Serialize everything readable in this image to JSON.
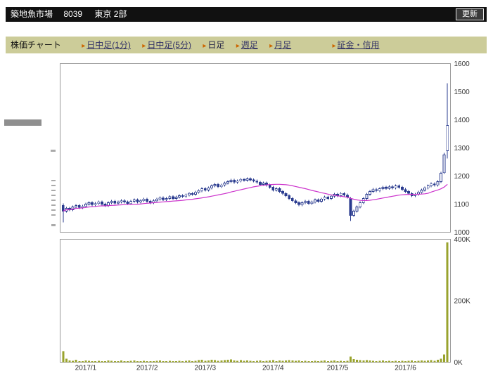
{
  "header": {
    "name": "築地魚市場",
    "code": "8039",
    "market": "東京 2部",
    "refresh_label": "更新"
  },
  "nav": {
    "label": "株価チャート",
    "bullet": "▸",
    "items": [
      {
        "label": "日中足(1分)",
        "active": false
      },
      {
        "label": "日中足(5分)",
        "active": false
      },
      {
        "label": "日足",
        "active": true
      },
      {
        "label": "週足",
        "active": false
      },
      {
        "label": "月足",
        "active": false
      },
      {
        "label": "証金・信用",
        "active": false
      }
    ]
  },
  "chart_data": {
    "type": "candlestick_with_volume",
    "title": "",
    "x_range": "2017/1 - 2017/6",
    "y_axis": {
      "min": 1000,
      "max": 1600,
      "ticks": [
        1000,
        1100,
        1200,
        1300,
        1400,
        1500,
        1600
      ],
      "position": "right"
    },
    "volume_axis": {
      "min": 0,
      "max": 400000,
      "position": "right",
      "ticks": [
        {
          "label": "0K",
          "value": 0
        },
        {
          "label": "200K",
          "value": 200000
        },
        {
          "label": "400K",
          "value": 400000
        }
      ]
    },
    "x_ticks": [
      {
        "label": "2017/1",
        "center_index": 7
      },
      {
        "label": "2017/2",
        "center_index": 26
      },
      {
        "label": "2017/3",
        "center_index": 44
      },
      {
        "label": "2017/4",
        "center_index": 65
      },
      {
        "label": "2017/5",
        "center_index": 85
      },
      {
        "label": "2017/6",
        "center_index": 106
      }
    ],
    "ma_period": 25,
    "colors": {
      "candle": "#2a3b8f",
      "candle_up_fill": "#ffffff",
      "ma": "#cc33cc",
      "volume": "#99a32e",
      "border": "#999999"
    },
    "candles": [
      [
        1095,
        1102,
        1035,
        1075
      ],
      [
        1075,
        1090,
        1070,
        1085
      ],
      [
        1085,
        1090,
        1075,
        1080
      ],
      [
        1080,
        1095,
        1075,
        1090
      ],
      [
        1090,
        1100,
        1085,
        1095
      ],
      [
        1095,
        1100,
        1083,
        1088
      ],
      [
        1088,
        1097,
        1083,
        1092
      ],
      [
        1092,
        1105,
        1087,
        1100
      ],
      [
        1100,
        1110,
        1095,
        1105
      ],
      [
        1105,
        1110,
        1093,
        1098
      ],
      [
        1098,
        1107,
        1093,
        1102
      ],
      [
        1102,
        1113,
        1097,
        1108
      ],
      [
        1108,
        1113,
        1095,
        1100
      ],
      [
        1100,
        1105,
        1090,
        1095
      ],
      [
        1095,
        1110,
        1090,
        1105
      ],
      [
        1105,
        1115,
        1100,
        1110
      ],
      [
        1110,
        1115,
        1099,
        1104
      ],
      [
        1104,
        1113,
        1099,
        1108
      ],
      [
        1108,
        1117,
        1103,
        1112
      ],
      [
        1112,
        1117,
        1103,
        1108
      ],
      [
        1108,
        1113,
        1097,
        1102
      ],
      [
        1102,
        1115,
        1097,
        1110
      ],
      [
        1110,
        1120,
        1105,
        1115
      ],
      [
        1115,
        1120,
        1103,
        1108
      ],
      [
        1108,
        1117,
        1103,
        1112
      ],
      [
        1112,
        1123,
        1107,
        1118
      ],
      [
        1118,
        1123,
        1105,
        1110
      ],
      [
        1110,
        1115,
        1100,
        1105
      ],
      [
        1105,
        1117,
        1100,
        1112
      ],
      [
        1112,
        1123,
        1107,
        1118
      ],
      [
        1118,
        1127,
        1113,
        1122
      ],
      [
        1122,
        1127,
        1111,
        1116
      ],
      [
        1116,
        1125,
        1111,
        1120
      ],
      [
        1120,
        1131,
        1115,
        1126
      ],
      [
        1126,
        1131,
        1115,
        1120
      ],
      [
        1120,
        1130,
        1115,
        1125
      ],
      [
        1125,
        1135,
        1120,
        1130
      ],
      [
        1130,
        1135,
        1123,
        1128
      ],
      [
        1128,
        1137,
        1123,
        1132
      ],
      [
        1132,
        1143,
        1127,
        1138
      ],
      [
        1138,
        1143,
        1130,
        1135
      ],
      [
        1135,
        1147,
        1130,
        1142
      ],
      [
        1142,
        1153,
        1137,
        1148
      ],
      [
        1148,
        1160,
        1143,
        1155
      ],
      [
        1155,
        1160,
        1145,
        1150
      ],
      [
        1150,
        1163,
        1145,
        1158
      ],
      [
        1158,
        1170,
        1153,
        1165
      ],
      [
        1165,
        1175,
        1160,
        1170
      ],
      [
        1170,
        1175,
        1157,
        1162
      ],
      [
        1162,
        1173,
        1157,
        1168
      ],
      [
        1168,
        1180,
        1163,
        1175
      ],
      [
        1175,
        1185,
        1170,
        1180
      ],
      [
        1180,
        1190,
        1175,
        1185
      ],
      [
        1185,
        1190,
        1173,
        1178
      ],
      [
        1178,
        1187,
        1173,
        1182
      ],
      [
        1182,
        1193,
        1177,
        1188
      ],
      [
        1188,
        1193,
        1180,
        1185
      ],
      [
        1185,
        1195,
        1180,
        1190
      ],
      [
        1190,
        1195,
        1181,
        1186
      ],
      [
        1186,
        1191,
        1177,
        1182
      ],
      [
        1182,
        1187,
        1173,
        1178
      ],
      [
        1178,
        1183,
        1165,
        1170
      ],
      [
        1170,
        1180,
        1165,
        1175
      ],
      [
        1175,
        1180,
        1163,
        1168
      ],
      [
        1168,
        1173,
        1155,
        1160
      ],
      [
        1160,
        1165,
        1145,
        1150
      ],
      [
        1150,
        1160,
        1145,
        1155
      ],
      [
        1155,
        1160,
        1140,
        1145
      ],
      [
        1145,
        1150,
        1133,
        1138
      ],
      [
        1138,
        1143,
        1125,
        1130
      ],
      [
        1130,
        1135,
        1115,
        1120
      ],
      [
        1120,
        1125,
        1107,
        1112
      ],
      [
        1112,
        1117,
        1100,
        1105
      ],
      [
        1105,
        1110,
        1093,
        1098
      ],
      [
        1098,
        1110,
        1093,
        1105
      ],
      [
        1105,
        1115,
        1100,
        1110
      ],
      [
        1110,
        1115,
        1097,
        1102
      ],
      [
        1102,
        1113,
        1097,
        1108
      ],
      [
        1108,
        1120,
        1103,
        1115
      ],
      [
        1115,
        1120,
        1105,
        1110
      ],
      [
        1110,
        1123,
        1105,
        1118
      ],
      [
        1118,
        1130,
        1113,
        1125
      ],
      [
        1125,
        1130,
        1115,
        1120
      ],
      [
        1120,
        1133,
        1115,
        1128
      ],
      [
        1128,
        1140,
        1123,
        1135
      ],
      [
        1135,
        1140,
        1125,
        1130
      ],
      [
        1130,
        1143,
        1125,
        1138
      ],
      [
        1138,
        1143,
        1127,
        1132
      ],
      [
        1132,
        1137,
        1120,
        1125
      ],
      [
        1120,
        1125,
        1040,
        1060
      ],
      [
        1060,
        1080,
        1055,
        1075
      ],
      [
        1075,
        1095,
        1070,
        1090
      ],
      [
        1090,
        1110,
        1085,
        1105
      ],
      [
        1105,
        1125,
        1100,
        1120
      ],
      [
        1120,
        1140,
        1115,
        1135
      ],
      [
        1135,
        1150,
        1130,
        1145
      ],
      [
        1145,
        1157,
        1140,
        1152
      ],
      [
        1152,
        1157,
        1143,
        1148
      ],
      [
        1148,
        1160,
        1143,
        1155
      ],
      [
        1155,
        1165,
        1150,
        1160
      ],
      [
        1160,
        1165,
        1151,
        1156
      ],
      [
        1156,
        1167,
        1151,
        1162
      ],
      [
        1162,
        1167,
        1153,
        1158
      ],
      [
        1158,
        1170,
        1153,
        1165
      ],
      [
        1165,
        1170,
        1155,
        1160
      ],
      [
        1160,
        1165,
        1147,
        1152
      ],
      [
        1152,
        1157,
        1140,
        1145
      ],
      [
        1145,
        1150,
        1133,
        1138
      ],
      [
        1138,
        1143,
        1125,
        1130
      ],
      [
        1130,
        1140,
        1125,
        1135
      ],
      [
        1135,
        1147,
        1130,
        1142
      ],
      [
        1142,
        1155,
        1137,
        1150
      ],
      [
        1150,
        1163,
        1145,
        1158
      ],
      [
        1158,
        1170,
        1153,
        1165
      ],
      [
        1165,
        1177,
        1160,
        1172
      ],
      [
        1172,
        1177,
        1163,
        1168
      ],
      [
        1168,
        1185,
        1163,
        1180
      ],
      [
        1180,
        1215,
        1175,
        1210
      ],
      [
        1212,
        1283,
        1207,
        1275
      ],
      [
        1290,
        1530,
        1262,
        1380
      ]
    ],
    "volumes_k": [
      35,
      12,
      6,
      5,
      8,
      4,
      3,
      6,
      5,
      4,
      3,
      5,
      4,
      3,
      6,
      5,
      3,
      4,
      6,
      4,
      3,
      5,
      6,
      4,
      3,
      5,
      4,
      3,
      4,
      5,
      6,
      4,
      3,
      5,
      4,
      3,
      5,
      4,
      5,
      6,
      4,
      5,
      7,
      8,
      5,
      6,
      8,
      7,
      5,
      6,
      7,
      8,
      9,
      6,
      5,
      7,
      5,
      6,
      5,
      4,
      5,
      6,
      4,
      5,
      6,
      7,
      4,
      6,
      5,
      6,
      7,
      6,
      5,
      6,
      4,
      5,
      4,
      3,
      5,
      4,
      5,
      6,
      4,
      5,
      6,
      4,
      5,
      4,
      5,
      18,
      10,
      8,
      7,
      6,
      7,
      6,
      5,
      4,
      5,
      6,
      4,
      5,
      4,
      5,
      4,
      5,
      4,
      5,
      6,
      4,
      5,
      6,
      5,
      6,
      7,
      5,
      8,
      12,
      25,
      390
    ]
  }
}
